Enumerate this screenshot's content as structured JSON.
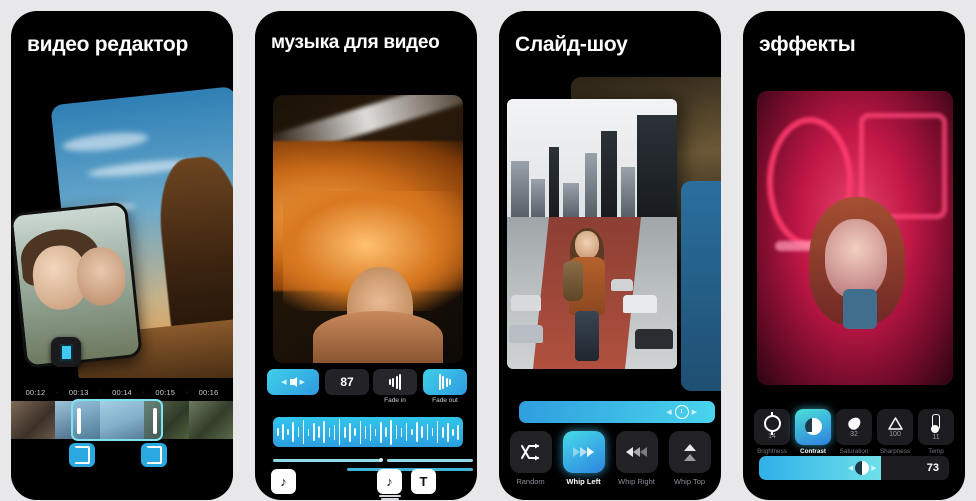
{
  "gallery": {
    "panels": [
      {
        "title": "видео редактор",
        "timeline": {
          "timestamps": [
            "00:12",
            "00:13",
            "00:14",
            "00:15",
            "00:16"
          ],
          "separator": "·",
          "transition_icon": "transition-icon",
          "split_icon": "split-handle-icon"
        }
      },
      {
        "title": "музыка для видео",
        "audio": {
          "volume_icon": "speaker-icon",
          "volume_value": "87",
          "fade_in_label": "Fade in",
          "fade_out_label": "Fade out",
          "fade_in_icon": "fade-in-icon",
          "fade_out_icon": "fade-out-icon",
          "waveform_icon": "audio-waveform",
          "music_icon": "music-note-icon",
          "text_icon": "T"
        }
      },
      {
        "title": "Слайд-шоу",
        "duration": {
          "clock_icon": "clock-icon"
        },
        "transitions": [
          {
            "label": "Random",
            "icon": "shuffle-icon",
            "selected": false
          },
          {
            "label": "Whip Left",
            "icon": "whip-left-icon",
            "selected": true
          },
          {
            "label": "Whip Right",
            "icon": "whip-right-icon",
            "selected": false
          },
          {
            "label": "Whip Top",
            "icon": "whip-top-icon",
            "selected": false
          }
        ]
      },
      {
        "title": "эффекты",
        "adjustments": [
          {
            "label": "Brightness",
            "value": "14",
            "icon": "brightness-icon",
            "selected": false
          },
          {
            "label": "Contrast",
            "value": "",
            "icon": "contrast-icon",
            "selected": true
          },
          {
            "label": "Saturation",
            "value": "32",
            "icon": "saturation-icon",
            "selected": false
          },
          {
            "label": "Sharpness",
            "value": "100",
            "icon": "sharpness-icon",
            "selected": false
          },
          {
            "label": "Temp",
            "value": "11",
            "icon": "temperature-icon",
            "selected": false
          }
        ],
        "slider": {
          "value": "73",
          "handle_icon": "contrast-icon"
        }
      }
    ]
  },
  "colors": {
    "accent_cyan": "#3fd0e8",
    "accent_blue": "#2f84e0",
    "background": "#e8e8ea",
    "card": "#000000"
  }
}
